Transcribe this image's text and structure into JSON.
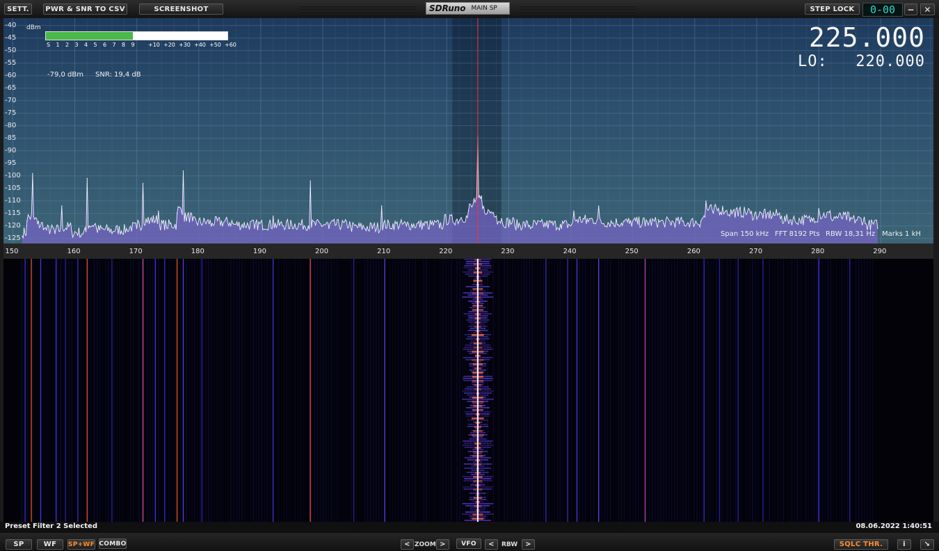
{
  "toolbar": {
    "settings": "SETT.",
    "pwr_snr_csv": "PWR & SNR TO CSV",
    "screenshot": "SCREENSHOT",
    "app_brand": "SDRuno",
    "window_name": "MAIN SP",
    "step_lock": "STEP LOCK",
    "lcd_value": "0-00",
    "minimize": "−",
    "close": "✕"
  },
  "spectrum": {
    "unit_label": "dBm",
    "db_ticks": [
      "-40",
      "-45",
      "-50",
      "-55",
      "-60",
      "-65",
      "-70",
      "-75",
      "-80",
      "-85",
      "-90",
      "-95",
      "-100",
      "-105",
      "-110",
      "-115",
      "-120",
      "-125"
    ],
    "smeter_ticks": [
      "S",
      "1",
      "2",
      "3",
      "4",
      "5",
      "6",
      "7",
      "8",
      "9",
      "+10",
      "+20",
      "+30",
      "+40",
      "+50",
      "+60"
    ],
    "smeter_level_fraction": 0.48,
    "power_readout": "-79,0 dBm",
    "snr_readout": "SNR: 19,4 dB",
    "vfo_frequency": "225.000",
    "lo_label": "LO:",
    "lo_frequency": "220.000",
    "span_info": "Span 150 kHz",
    "fft_info": "FFT 8192 Pts",
    "rbw_info": "RBW 18,31 Hz",
    "marks_info": "Marks 1 kH"
  },
  "freq_axis": {
    "ticks": [
      "150",
      "160",
      "170",
      "180",
      "190",
      "200",
      "210",
      "220",
      "230",
      "240",
      "250",
      "260",
      "270",
      "280",
      "290"
    ]
  },
  "chart_data": {
    "type": "line",
    "title": "",
    "xlabel": "",
    "ylabel": "dBm",
    "xlim": [
      148.5,
      298.5
    ],
    "ylim": [
      -127,
      -37
    ],
    "center_frequency": 225.0,
    "filter_range": [
      220.9,
      228.8
    ],
    "series": [
      {
        "name": "",
        "x": [
          151.5,
          152.3,
          153.2,
          154.0,
          155.1,
          156.8,
          157.9,
          159.5,
          161.0,
          162.0,
          163.5,
          166.0,
          168.5,
          170.0,
          171.0,
          172.0,
          173.5,
          175.0,
          176.5,
          177.5,
          179.0,
          182.0,
          185.5,
          189.0,
          192.0,
          194.5,
          198.0,
          201.0,
          204.5,
          207.5,
          209.5,
          211.0,
          213.5,
          217.0,
          219.5,
          222.0,
          223.5,
          224.4,
          225.0,
          225.6,
          226.5,
          228.0,
          229.0,
          231.0,
          233.5,
          236.5,
          238.5,
          240.5,
          242.5,
          244.5,
          247.0,
          249.5,
          252.0,
          255.0,
          258.5,
          261.0,
          261.8,
          263.0,
          265.0,
          267.0,
          269.0,
          271.5,
          274.0,
          276.5,
          279.0,
          280.0,
          282.0,
          285.0,
          287.5,
          289.5
        ],
        "values": [
          -124,
          -118,
          -99,
          -119,
          -121,
          -123,
          -112,
          -122,
          -124,
          -101,
          -121,
          -123,
          -122,
          -121,
          -103,
          -119,
          -114,
          -121,
          -115,
          -98,
          -118,
          -120,
          -119,
          -121,
          -116,
          -121,
          -102,
          -121,
          -120,
          -122,
          -112,
          -121,
          -120,
          -121,
          -119,
          -118,
          -114,
          -109,
          -84,
          -108,
          -115,
          -116,
          -119,
          -120,
          -121,
          -118,
          -121,
          -114,
          -119,
          -112,
          -120,
          -119,
          -120,
          -119,
          -120,
          -118,
          -110,
          -115,
          -114,
          -116,
          -115,
          -117,
          -116,
          -119,
          -118,
          -113,
          -117,
          -118,
          -119,
          -121
        ]
      }
    ]
  },
  "waterfall": {
    "colors": {
      "bg": "#020208",
      "faint": "#2a26b0",
      "mid": "#6a48ff",
      "hot": "#ff6a3c",
      "core": "#ffffff"
    },
    "lines": [
      {
        "f": 152.0,
        "c": "#3c32d8"
      },
      {
        "f": 153.0,
        "c": "#ff5a30"
      },
      {
        "f": 154.5,
        "c": "#4a3cf0"
      },
      {
        "f": 157.0,
        "c": "#4a3cf0"
      },
      {
        "f": 158.5,
        "c": "#2a26b0"
      },
      {
        "f": 160.5,
        "c": "#3c32d8"
      },
      {
        "f": 162.0,
        "c": "#ff5a30"
      },
      {
        "f": 166.0,
        "c": "#2a26b0"
      },
      {
        "f": 171.0,
        "c": "#e85ab0"
      },
      {
        "f": 173.0,
        "c": "#4a3cf0"
      },
      {
        "f": 174.5,
        "c": "#3c32d8"
      },
      {
        "f": 176.5,
        "c": "#ff5a30"
      },
      {
        "f": 177.5,
        "c": "#5a46ff"
      },
      {
        "f": 180.5,
        "c": "#2a26b0"
      },
      {
        "f": 192.0,
        "c": "#4a3cf0"
      },
      {
        "f": 198.0,
        "c": "#ff5a30"
      },
      {
        "f": 205.0,
        "c": "#2a26b0"
      },
      {
        "f": 210.0,
        "c": "#5a46ff"
      },
      {
        "f": 236.0,
        "c": "#3c32d8"
      },
      {
        "f": 239.5,
        "c": "#3c32d8"
      },
      {
        "f": 241.0,
        "c": "#4a3cf0"
      },
      {
        "f": 244.5,
        "c": "#6a48ff"
      },
      {
        "f": 252.0,
        "c": "#c84cd0"
      },
      {
        "f": 261.5,
        "c": "#3c32d8"
      },
      {
        "f": 264.0,
        "c": "#2a26b0"
      },
      {
        "f": 267.0,
        "c": "#2a26b0"
      },
      {
        "f": 271.0,
        "c": "#2a26b0"
      },
      {
        "f": 280.0,
        "c": "#4a3cf0"
      },
      {
        "f": 285.0,
        "c": "#2a26b0"
      }
    ]
  },
  "status": {
    "message": "Preset Filter 2 Selected",
    "datetime": "08.06.2022 1:40:51"
  },
  "bottom": {
    "sp": "SP",
    "wf": "WF",
    "sp_wf": "SP+WF",
    "combo": "COMBO",
    "zoom_left": "<",
    "zoom_label": "ZOOM",
    "zoom_right": ">",
    "vfo": "VFO",
    "rbw_left": "<",
    "rbw_label": "RBW",
    "rbw_right": ">",
    "sqlc": "SQLC THR.",
    "info": "i",
    "resize": "↘"
  }
}
